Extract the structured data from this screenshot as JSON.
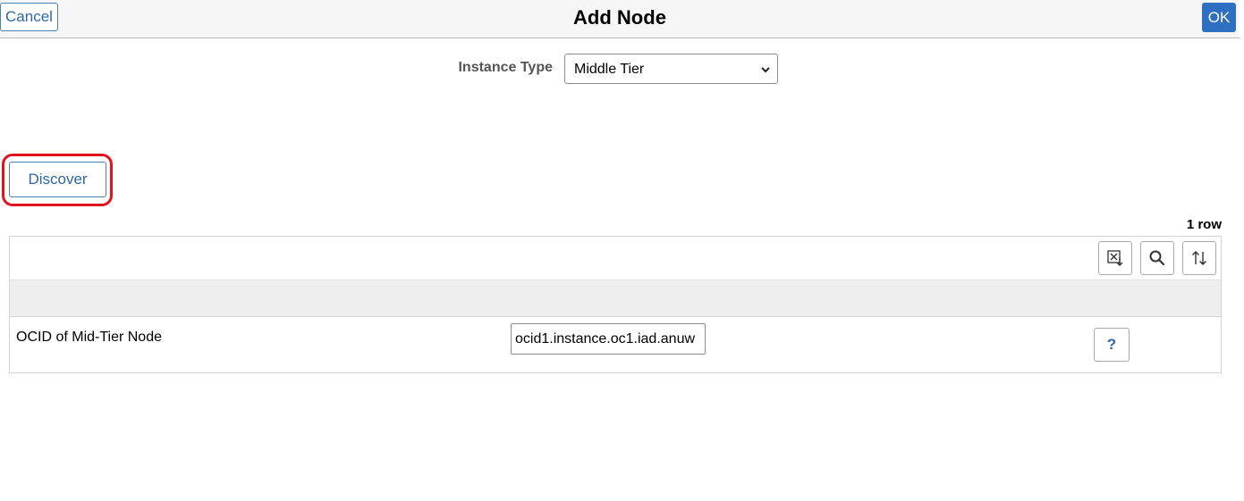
{
  "header": {
    "cancel_label": "Cancel",
    "title": "Add Node",
    "ok_label": "OK"
  },
  "form": {
    "instance_type_label": "Instance Type",
    "instance_type_value": "Middle Tier"
  },
  "discover_label": "Discover",
  "grid": {
    "row_count": "1 row",
    "toolbar_icons": [
      "export-excel-icon",
      "search-icon",
      "sort-icon"
    ],
    "rows": [
      {
        "label": "OCID of Mid-Tier Node",
        "value": "ocid1.instance.oc1.iad.anuw",
        "help_label": "?"
      }
    ]
  },
  "colors": {
    "accent": "#2f6fc2",
    "link": "#2f67a7",
    "highlight": "#e0141e"
  }
}
